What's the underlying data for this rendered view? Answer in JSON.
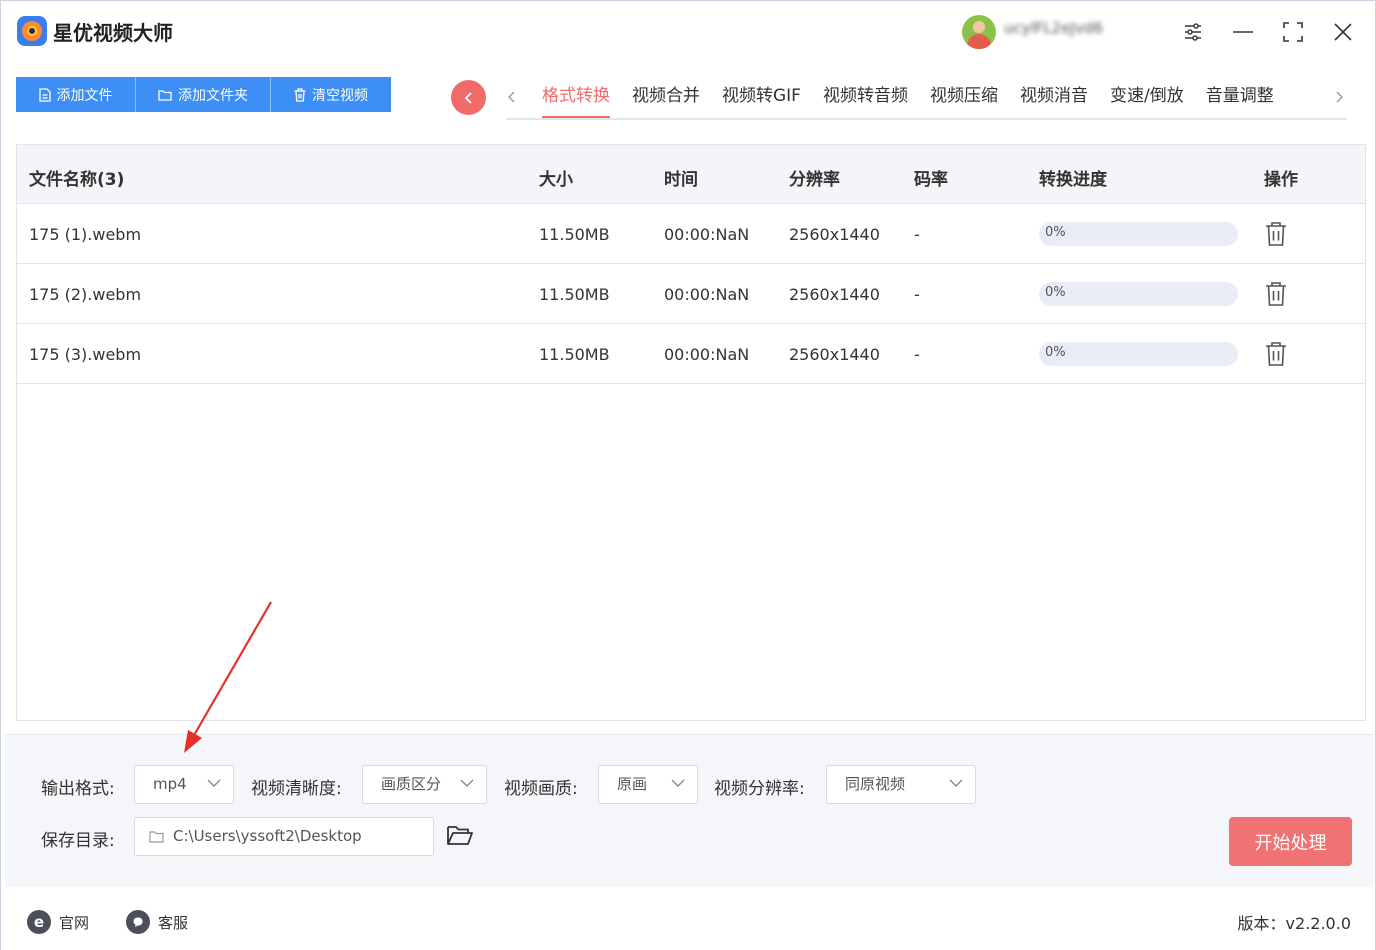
{
  "app": {
    "title": "星优视频大师",
    "username": "ucylFL2eJvd6"
  },
  "toolbar": {
    "add_file": "添加文件",
    "add_folder": "添加文件夹",
    "clear_video": "清空视频"
  },
  "tabs": [
    {
      "label": "格式转换",
      "active": true
    },
    {
      "label": "视频合并"
    },
    {
      "label": "视频转GIF"
    },
    {
      "label": "视频转音频"
    },
    {
      "label": "视频压缩"
    },
    {
      "label": "视频消音"
    },
    {
      "label": "变速/倒放"
    },
    {
      "label": "音量调整"
    }
  ],
  "table": {
    "headers": {
      "name": "文件名称(3)",
      "size": "大小",
      "time": "时间",
      "resolution": "分辨率",
      "bitrate": "码率",
      "progress": "转换进度",
      "action": "操作"
    },
    "rows": [
      {
        "name": "175 (1).webm",
        "size": "11.50MB",
        "time": "00:00:NaN",
        "resolution": "2560x1440",
        "bitrate": "-",
        "progress_text": "0%",
        "progress": 0
      },
      {
        "name": "175 (2).webm",
        "size": "11.50MB",
        "time": "00:00:NaN",
        "resolution": "2560x1440",
        "bitrate": "-",
        "progress_text": "0%",
        "progress": 0
      },
      {
        "name": "175 (3).webm",
        "size": "11.50MB",
        "time": "00:00:NaN",
        "resolution": "2560x1440",
        "bitrate": "-",
        "progress_text": "0%",
        "progress": 0
      }
    ]
  },
  "settings": {
    "output_format_label": "输出格式:",
    "output_format_value": "mp4",
    "clarity_label": "视频清晰度:",
    "clarity_value": "画质区分",
    "quality_label": "视频画质:",
    "quality_value": "原画",
    "resolution_label": "视频分辨率:",
    "resolution_value": "同原视频",
    "save_dir_label": "保存目录:",
    "save_dir_value": "C:\\Users\\yssoft2\\Desktop",
    "start_label": "开始处理"
  },
  "footer": {
    "website": "官网",
    "support": "客服",
    "version": "版本：v2.2.0.0"
  },
  "colors": {
    "accent_blue": "#3d8ef5",
    "accent_red": "#f26b6b",
    "start_button": "#f07272",
    "annotation_arrow": "#e8302b"
  }
}
